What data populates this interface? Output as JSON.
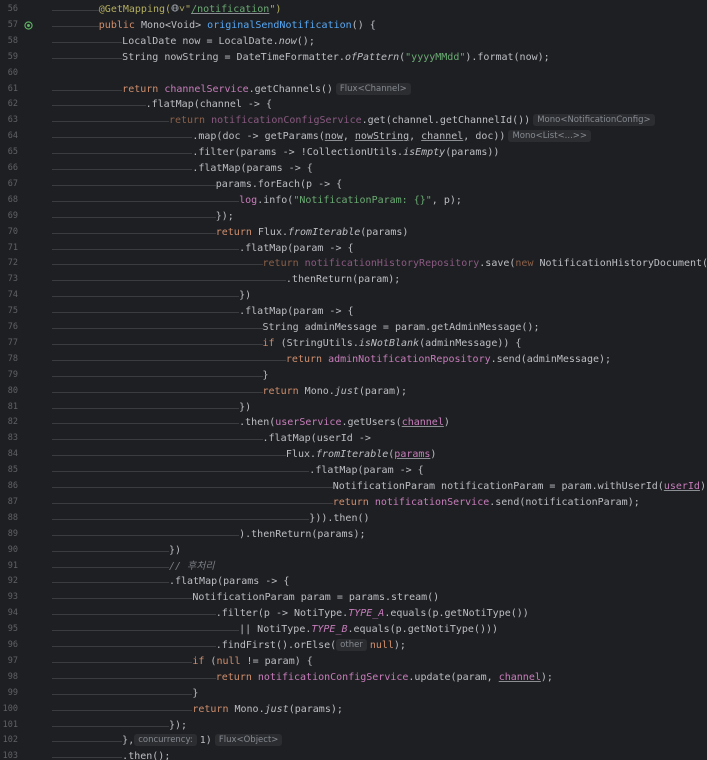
{
  "editor": {
    "language": "Java",
    "lines": [
      {
        "num": "56",
        "indent": 2,
        "segs": [
          {
            "c": "ann",
            "t": "@GetMapping("
          },
          {
            "icon": "globe-icon"
          },
          {
            "c": "ann",
            "t": "˅\""
          },
          {
            "c": "str und",
            "t": "/notification"
          },
          {
            "c": "ann",
            "t": "\")"
          }
        ]
      },
      {
        "num": "57",
        "indent": 2,
        "gutter_icon": "run-gutter-icon",
        "segs": [
          {
            "c": "kw",
            "t": "public "
          },
          {
            "t": "Mono<Void> "
          },
          {
            "c": "fn",
            "t": "originalSendNotification"
          },
          {
            "t": "() {"
          }
        ]
      },
      {
        "num": "58",
        "indent": 3,
        "segs": [
          {
            "t": "LocalDate now = LocalDate."
          },
          {
            "c": "ital",
            "t": "now"
          },
          {
            "t": "();"
          }
        ]
      },
      {
        "num": "59",
        "indent": 3,
        "segs": [
          {
            "t": "String nowString = DateTimeFormatter."
          },
          {
            "c": "ital",
            "t": "ofPattern"
          },
          {
            "t": "("
          },
          {
            "c": "str",
            "t": "\"yyyyMMdd\""
          },
          {
            "t": ").format(now);"
          }
        ]
      },
      {
        "num": "60",
        "indent": 0,
        "segs": []
      },
      {
        "num": "61",
        "indent": 3,
        "segs": [
          {
            "c": "kw",
            "t": "return "
          },
          {
            "c": "fld",
            "t": "channelService"
          },
          {
            "t": ".getChannels()"
          },
          {
            "hint": "Flux<Channel>"
          }
        ]
      },
      {
        "num": "62",
        "indent": 4,
        "segs": [
          {
            "t": ".flatMap(channel -> {"
          }
        ]
      },
      {
        "num": "63",
        "indent": 5,
        "segs": [
          {
            "c": "kw-dim",
            "t": "return "
          },
          {
            "c": "fld-dim",
            "t": "notificationConfigService"
          },
          {
            "t": ".get(channel.getChannelId())"
          },
          {
            "hint": "Mono<NotificationConfig>"
          }
        ]
      },
      {
        "num": "64",
        "indent": 6,
        "segs": [
          {
            "t": ".map(doc -> getParams("
          },
          {
            "c": "und",
            "t": "now"
          },
          {
            "t": ", "
          },
          {
            "c": "und",
            "t": "nowString"
          },
          {
            "t": ", "
          },
          {
            "c": "und",
            "t": "channel"
          },
          {
            "t": ", doc))"
          },
          {
            "hint": "Mono<List<...>>"
          }
        ]
      },
      {
        "num": "65",
        "indent": 6,
        "segs": [
          {
            "t": ".filter(params -> !CollectionUtils."
          },
          {
            "c": "ital",
            "t": "isEmpty"
          },
          {
            "t": "(params))"
          }
        ]
      },
      {
        "num": "66",
        "indent": 6,
        "segs": [
          {
            "t": ".flatMap(params -> {"
          }
        ]
      },
      {
        "num": "67",
        "indent": 7,
        "segs": [
          {
            "t": "params.forEach(p -> {"
          }
        ]
      },
      {
        "num": "68",
        "indent": 8,
        "segs": [
          {
            "c": "fld",
            "t": "log"
          },
          {
            "t": ".info("
          },
          {
            "c": "str",
            "t": "\"NotificationParam: {}\""
          },
          {
            "t": ", p);"
          }
        ]
      },
      {
        "num": "69",
        "indent": 7,
        "segs": [
          {
            "t": "});"
          }
        ]
      },
      {
        "num": "70",
        "indent": 7,
        "segs": [
          {
            "c": "kw",
            "t": "return "
          },
          {
            "t": "Flux."
          },
          {
            "c": "ital",
            "t": "fromIterable"
          },
          {
            "t": "(params)"
          }
        ]
      },
      {
        "num": "71",
        "indent": 8,
        "segs": [
          {
            "t": ".flatMap(param -> {"
          }
        ]
      },
      {
        "num": "72",
        "indent": 9,
        "segs": [
          {
            "c": "kw-dim",
            "t": "return "
          },
          {
            "c": "fld-dim",
            "t": "notificationHistoryRepository"
          },
          {
            "t": ".save("
          },
          {
            "c": "kw-dim",
            "t": "new "
          },
          {
            "t": "NotificationHistoryDocument(param))"
          }
        ]
      },
      {
        "num": "73",
        "indent": 10,
        "segs": [
          {
            "t": ".thenReturn(param);"
          }
        ]
      },
      {
        "num": "74",
        "indent": 8,
        "segs": [
          {
            "t": "})"
          }
        ]
      },
      {
        "num": "75",
        "indent": 8,
        "segs": [
          {
            "t": ".flatMap(param -> {"
          }
        ]
      },
      {
        "num": "76",
        "indent": 9,
        "segs": [
          {
            "t": "String adminMessage = param.getAdminMessage();"
          }
        ]
      },
      {
        "num": "77",
        "indent": 9,
        "segs": [
          {
            "c": "kw",
            "t": "if "
          },
          {
            "t": "(StringUtils."
          },
          {
            "c": "ital",
            "t": "isNotBlank"
          },
          {
            "t": "(adminMessage)) {"
          }
        ]
      },
      {
        "num": "78",
        "indent": 10,
        "segs": [
          {
            "c": "kw",
            "t": "return "
          },
          {
            "c": "fld",
            "t": "adminNotificationRepository"
          },
          {
            "t": ".send(adminMessage);"
          }
        ]
      },
      {
        "num": "79",
        "indent": 9,
        "segs": [
          {
            "t": "}"
          }
        ]
      },
      {
        "num": "80",
        "indent": 9,
        "segs": [
          {
            "c": "kw",
            "t": "return "
          },
          {
            "t": "Mono."
          },
          {
            "c": "ital",
            "t": "just"
          },
          {
            "t": "(param);"
          }
        ]
      },
      {
        "num": "81",
        "indent": 8,
        "segs": [
          {
            "t": "})"
          }
        ]
      },
      {
        "num": "82",
        "indent": 8,
        "segs": [
          {
            "t": ".then("
          },
          {
            "c": "fld",
            "t": "userService"
          },
          {
            "t": ".getUsers("
          },
          {
            "c": "fld und",
            "t": "channel"
          },
          {
            "t": ")"
          }
        ]
      },
      {
        "num": "83",
        "indent": 9,
        "segs": [
          {
            "t": ".flatMap(userId ->"
          }
        ]
      },
      {
        "num": "84",
        "indent": 10,
        "segs": [
          {
            "t": "Flux."
          },
          {
            "c": "ital",
            "t": "fromIterable"
          },
          {
            "t": "("
          },
          {
            "c": "fld und",
            "t": "params"
          },
          {
            "t": ")"
          }
        ]
      },
      {
        "num": "85",
        "indent": 11,
        "segs": [
          {
            "t": ".flatMap(param -> {"
          }
        ]
      },
      {
        "num": "86",
        "indent": 12,
        "segs": [
          {
            "t": "NotificationParam notificationParam = param.withUserId("
          },
          {
            "c": "fld und",
            "t": "userId"
          },
          {
            "t": ");"
          }
        ]
      },
      {
        "num": "87",
        "indent": 12,
        "segs": [
          {
            "c": "kw",
            "t": "return "
          },
          {
            "c": "fld",
            "t": "notificationService"
          },
          {
            "t": ".send(notificationParam);"
          }
        ]
      },
      {
        "num": "88",
        "indent": 11,
        "segs": [
          {
            "t": "})).then()"
          }
        ]
      },
      {
        "num": "89",
        "indent": 8,
        "segs": [
          {
            "t": ").thenReturn(params);"
          }
        ]
      },
      {
        "num": "90",
        "indent": 5,
        "segs": [
          {
            "t": "})"
          }
        ]
      },
      {
        "num": "91",
        "indent": 5,
        "segs": [
          {
            "c": "cmt",
            "t": "// 후처리"
          }
        ]
      },
      {
        "num": "92",
        "indent": 5,
        "segs": [
          {
            "t": ".flatMap(params -> {"
          }
        ]
      },
      {
        "num": "93",
        "indent": 6,
        "segs": [
          {
            "t": "NotificationParam param = params.stream()"
          }
        ]
      },
      {
        "num": "94",
        "indent": 7,
        "segs": [
          {
            "t": ".filter(p -> NotiType."
          },
          {
            "c": "fld ital",
            "t": "TYPE_A"
          },
          {
            "t": ".equals(p.getNotiType())"
          }
        ]
      },
      {
        "num": "95",
        "indent": 8,
        "segs": [
          {
            "t": "|| NotiType."
          },
          {
            "c": "fld ital",
            "t": "TYPE_B"
          },
          {
            "t": ".equals(p.getNotiType()))"
          }
        ]
      },
      {
        "num": "96",
        "indent": 7,
        "segs": [
          {
            "t": ".findFirst().orElse("
          },
          {
            "hint": "other",
            "pre": true
          },
          {
            "c": "kw",
            "t": "null"
          },
          {
            "t": ");"
          }
        ]
      },
      {
        "num": "97",
        "indent": 6,
        "segs": [
          {
            "c": "kw",
            "t": "if "
          },
          {
            "t": "("
          },
          {
            "c": "kw",
            "t": "null "
          },
          {
            "t": "!= param) {"
          }
        ]
      },
      {
        "num": "98",
        "indent": 7,
        "segs": [
          {
            "c": "kw",
            "t": "return "
          },
          {
            "c": "fld",
            "t": "notificationConfigService"
          },
          {
            "t": ".update(param, "
          },
          {
            "c": "fld und",
            "t": "channel"
          },
          {
            "t": ");"
          }
        ]
      },
      {
        "num": "99",
        "indent": 6,
        "segs": [
          {
            "t": "}"
          }
        ]
      },
      {
        "num": "100",
        "indent": 6,
        "segs": [
          {
            "c": "kw",
            "t": "return "
          },
          {
            "t": "Mono."
          },
          {
            "c": "ital",
            "t": "just"
          },
          {
            "t": "(params);"
          }
        ]
      },
      {
        "num": "101",
        "indent": 5,
        "segs": [
          {
            "t": "});"
          }
        ]
      },
      {
        "num": "102",
        "indent": 3,
        "segs": [
          {
            "t": "},"
          },
          {
            "hint": "concurrency:",
            "pre": true
          },
          {
            "t": "1)"
          },
          {
            "hint": "Flux<Object>"
          }
        ]
      },
      {
        "num": "103",
        "indent": 3,
        "segs": [
          {
            "t": ".then();"
          }
        ]
      }
    ]
  },
  "colors": {
    "background": "#1e1f22",
    "keyword": "#cf8e6d",
    "field": "#c77dbb",
    "method_decl": "#56a8f5",
    "string": "#6aab73",
    "annotation": "#b3ae60",
    "comment": "#7a7e85",
    "line_number": "#5f6166"
  }
}
